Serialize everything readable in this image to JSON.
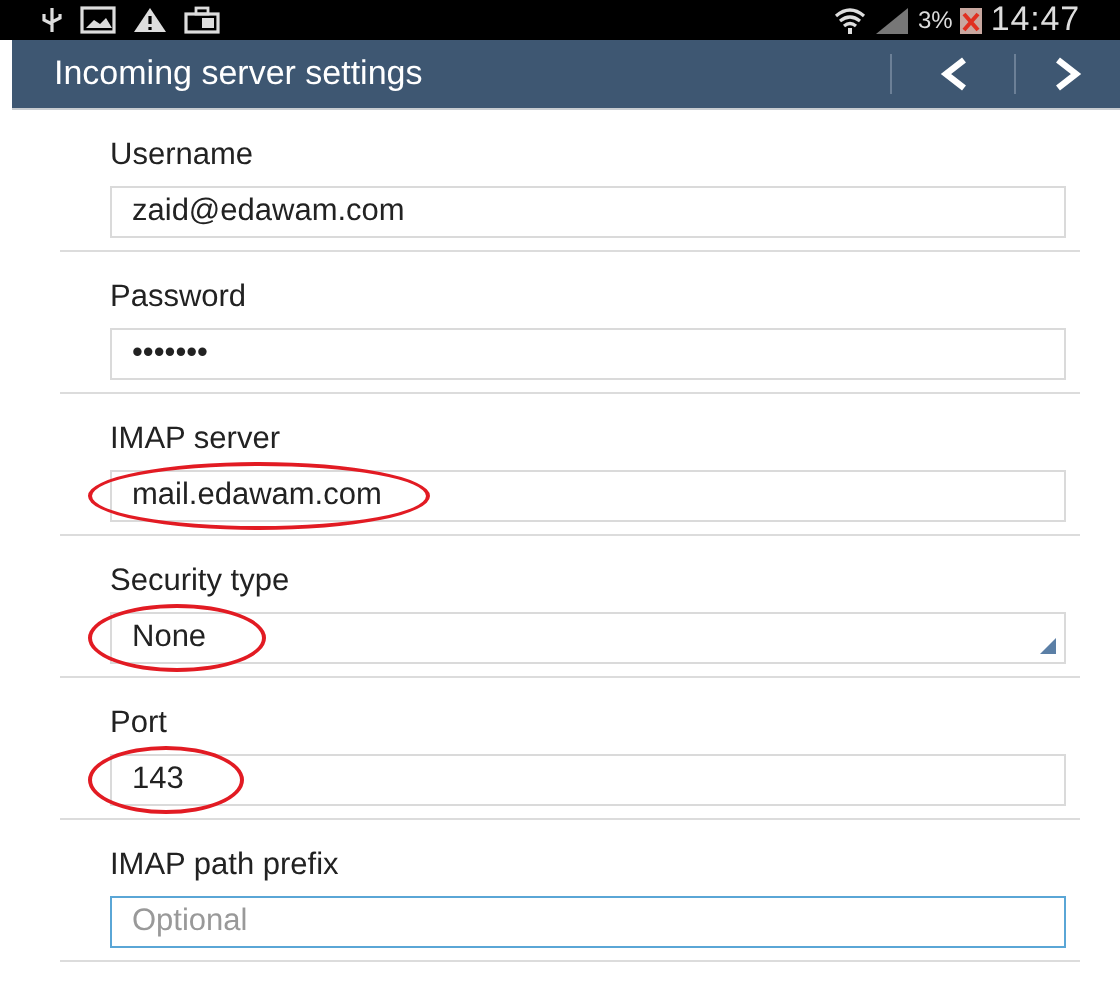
{
  "status_bar": {
    "battery": "3%",
    "time": "14:47"
  },
  "action_bar": {
    "title": "Incoming server settings"
  },
  "fields": [
    {
      "label": "Username",
      "kind": "text",
      "value": "zaid@edawam.com",
      "circled": false,
      "focused": false
    },
    {
      "label": "Password",
      "kind": "text",
      "value": "•••••••",
      "circled": false,
      "focused": false
    },
    {
      "label": "IMAP server",
      "kind": "text",
      "value": "mail.edawam.com",
      "circled": true,
      "focused": false
    },
    {
      "label": "Security type",
      "kind": "dropdown",
      "value": "None",
      "circled": true,
      "focused": false
    },
    {
      "label": "Port",
      "kind": "text",
      "value": "143",
      "circled": true,
      "focused": false
    },
    {
      "label": "IMAP path prefix",
      "kind": "text",
      "placeholder": "Optional",
      "circled": false,
      "focused": true
    }
  ]
}
